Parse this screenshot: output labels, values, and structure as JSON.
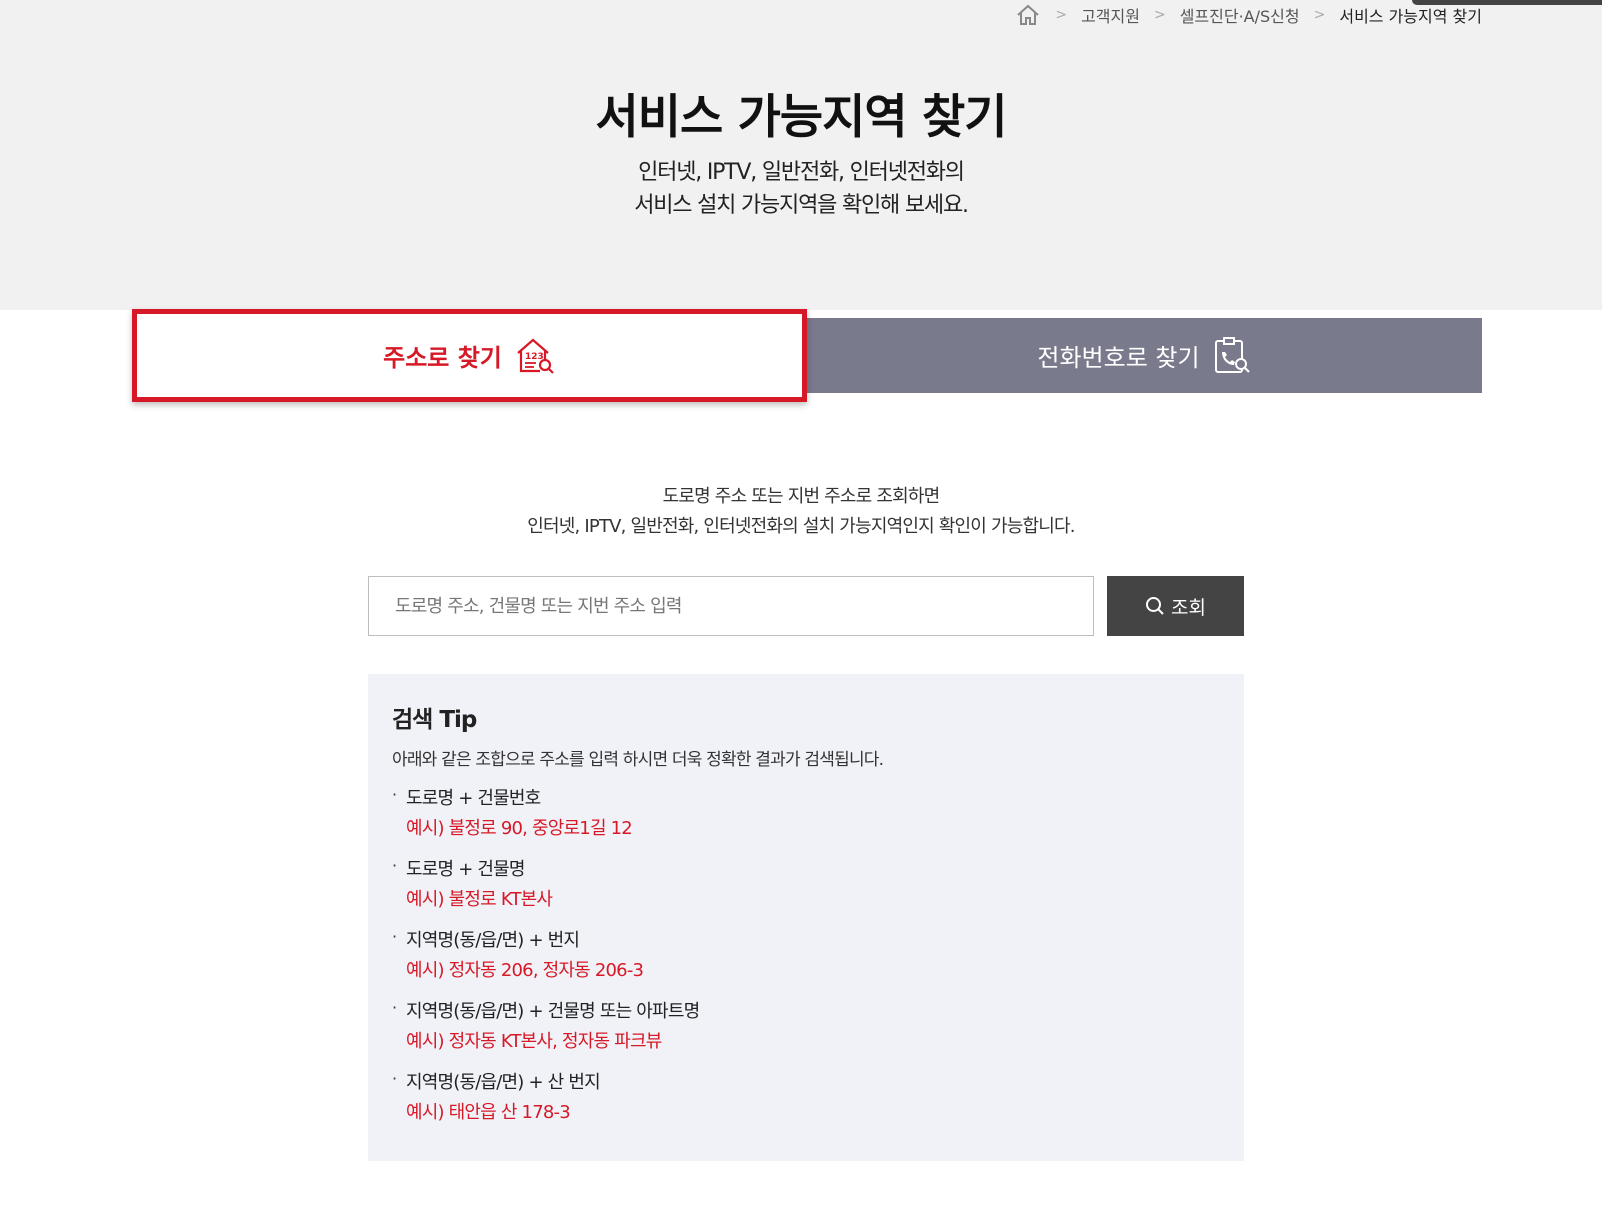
{
  "breadcrumb": {
    "home_icon": "home-icon",
    "items": [
      "고객지원",
      "셀프진단·A/S신청",
      "서비스 가능지역 찾기"
    ]
  },
  "hero": {
    "title": "서비스 가능지역 찾기",
    "subtitle_line1": "인터넷, IPTV, 일반전화, 인터넷전화의",
    "subtitle_line2": "서비스 설치 가능지역을 확인해 보세요."
  },
  "tabs": {
    "address": {
      "label": "주소로 찾기",
      "icon": "house-123-search-icon",
      "active": true
    },
    "phone": {
      "label": "전화번호로 찾기",
      "icon": "clipboard-phone-search-icon",
      "active": false
    }
  },
  "intro": {
    "line1": "도로명 주소 또는 지번 주소로 조회하면",
    "line2": "인터넷, IPTV, 일반전화, 인터넷전화의 설치 가능지역인지 확인이 가능합니다."
  },
  "search": {
    "placeholder": "도로명 주소, 건물명 또는 지번 주소 입력",
    "value": "",
    "button_label": "조회",
    "button_icon": "search-icon"
  },
  "tip": {
    "title": "검색 Tip",
    "description": "아래와 같은 조합으로 주소를 입력 하시면 더욱 정확한 결과가 검색됩니다.",
    "items": [
      {
        "combo": "도로명 + 건물번호",
        "example": "예시) 불정로 90, 중앙로1길 12"
      },
      {
        "combo": "도로명 + 건물명",
        "example": "예시) 불정로 KT본사"
      },
      {
        "combo": "지역명(동/읍/면) + 번지",
        "example": "예시) 정자동 206, 정자동 206-3"
      },
      {
        "combo": "지역명(동/읍/면) + 건물명 또는 아파트명",
        "example": "예시) 정자동 KT본사, 정자동 파크뷰"
      },
      {
        "combo": "지역명(동/읍/면) + 산 번지",
        "example": "예시) 태안읍 산 178-3"
      }
    ]
  },
  "colors": {
    "accent_red": "#d71826",
    "tab_inactive_bg": "#797a8c",
    "hero_bg": "#f1f1f1",
    "tip_bg": "#f1f2f8",
    "button_bg": "#444444"
  }
}
